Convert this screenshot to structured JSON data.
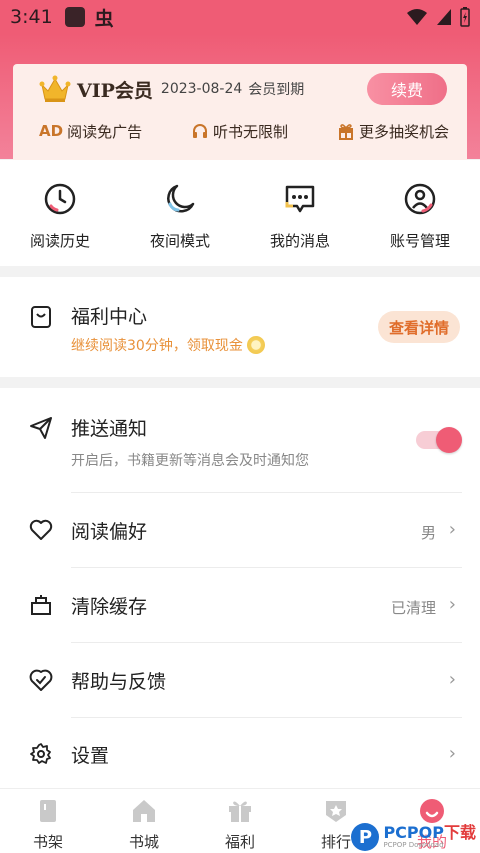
{
  "status_bar": {
    "time": "3:41",
    "glyph": "虫"
  },
  "vip": {
    "title": "VIP会员",
    "expiry_date": "2023-08-24",
    "expiry_text": "会员到期",
    "renew_label": "续费",
    "perks": [
      {
        "icon": "AD",
        "label": "阅读免广告"
      },
      {
        "icon": "headphones-icon",
        "label": "听书无限制"
      },
      {
        "icon": "gift-icon",
        "label": "更多抽奖机会"
      }
    ]
  },
  "quick_actions": [
    {
      "icon": "clock-icon",
      "label": "阅读历史"
    },
    {
      "icon": "moon-icon",
      "label": "夜间模式"
    },
    {
      "icon": "message-icon",
      "label": "我的消息"
    },
    {
      "icon": "account-icon",
      "label": "账号管理"
    }
  ],
  "welfare": {
    "title": "福利中心",
    "subtitle": "继续阅读30分钟，领取现金",
    "button_label": "查看详情"
  },
  "settings": {
    "push": {
      "label": "推送通知",
      "description": "开启后，书籍更新等消息会及时通知您",
      "enabled": true
    },
    "items": [
      {
        "icon": "heart-icon",
        "label": "阅读偏好",
        "value": "男"
      },
      {
        "icon": "clear-cache-icon",
        "label": "清除缓存",
        "value": "已清理"
      },
      {
        "icon": "help-icon",
        "label": "帮助与反馈",
        "value": ""
      },
      {
        "icon": "gear-icon",
        "label": "设置",
        "value": ""
      }
    ]
  },
  "tabbar": {
    "tabs": [
      {
        "icon": "bookshelf-icon",
        "label": "书架"
      },
      {
        "icon": "bookstore-icon",
        "label": "书城"
      },
      {
        "icon": "welfare-icon",
        "label": "福利"
      },
      {
        "icon": "ranking-icon",
        "label": "排行"
      },
      {
        "icon": "profile-icon",
        "label": "我的"
      }
    ],
    "active_index": 4
  },
  "watermark": {
    "brand": "PCPOP",
    "suffix": "下载",
    "tagline": "PCPOP Download"
  },
  "colors": {
    "accent": "#ef5c75",
    "orange": "#e8913a",
    "text": "#222222"
  }
}
